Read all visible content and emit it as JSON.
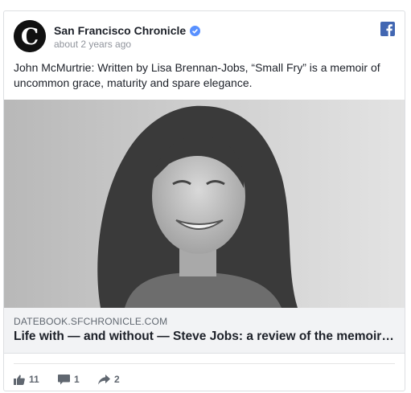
{
  "post": {
    "page_name": "San Francisco Chronicle",
    "timestamp": "about 2 years ago",
    "text": "John McMurtrie: Written by Lisa Brennan-Jobs, “Small Fry” is a memoir of uncommon grace, maturity and spare elegance.",
    "avatar_icon": "chronicle-logo-icon",
    "verified_icon": "verified-badge-icon",
    "platform_icon": "facebook-icon"
  },
  "link": {
    "domain": "DATEBOOK.SFCHRONICLE.COM",
    "title": "Life with — and without — Steve Jobs: a review of the memoir “Small Fry”"
  },
  "reactions": {
    "likes": "11",
    "comments": "1",
    "shares": "2"
  },
  "colors": {
    "brand_blue": "#4267b2",
    "verified_blue": "#5890ff",
    "text": "#1d2129",
    "muted": "#90949c"
  }
}
